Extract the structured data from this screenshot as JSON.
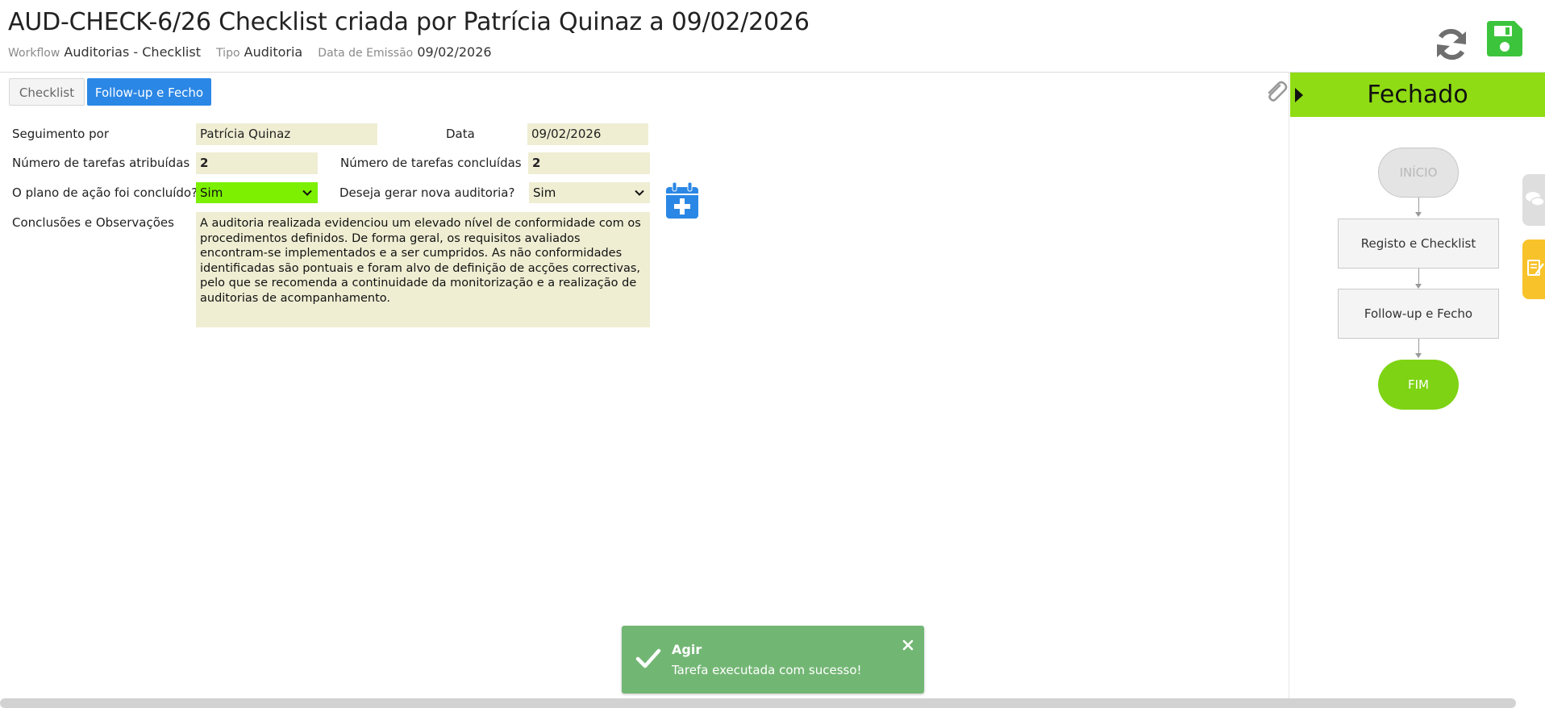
{
  "header": {
    "title": "AUD-CHECK-6/26 Checklist criada por Patrícia Quinaz a 09/02/2026",
    "workflow_label": "Workflow",
    "workflow_value": "Auditorias - Checklist",
    "tipo_label": "Tipo",
    "tipo_value": "Auditoria",
    "emissao_label": "Data de Emissão",
    "emissao_value": "09/02/2026"
  },
  "tabs": [
    {
      "label": "Checklist",
      "active": false
    },
    {
      "label": "Follow-up e Fecho",
      "active": true
    }
  ],
  "form": {
    "seguimento_label": "Seguimento por",
    "seguimento_value": "Patrícia Quinaz",
    "data_label": "Data",
    "data_value": "09/02/2026",
    "tarefas_atribuidas_label": "Número de tarefas atribuídas",
    "tarefas_atribuidas_value": "2",
    "tarefas_concluidas_label": "Número de tarefas concluídas",
    "tarefas_concluidas_value": "2",
    "plano_label": "O plano de ação foi concluído?",
    "plano_value": "Sim",
    "nova_auditoria_label": "Deseja gerar nova auditoria?",
    "nova_auditoria_value": "Sim",
    "conclusoes_label": "Conclusões e Observações",
    "conclusoes_value": "A auditoria realizada evidenciou um elevado nível de conformidade com os procedimentos definidos. De forma geral, os requisitos avaliados encontram-se implementados e a ser cumpridos. As não conformidades identificadas são pontuais e foram alvo de definição de acções correctivas, pelo que se recomenda a continuidade da monitorização e a realização de auditorias de acompanhamento."
  },
  "status": {
    "label": "Fechado",
    "color": "#8fdc14"
  },
  "flow": {
    "start": "INÍCIO",
    "steps": [
      "Registo e Checklist",
      "Follow-up e Fecho"
    ],
    "end": "FIM"
  },
  "toast": {
    "title": "Agir",
    "message": "Tarefa executada com sucesso!",
    "color": "#72b674"
  },
  "colors": {
    "accent": "#2b87e5",
    "field_bg": "#efeed3",
    "select_green": "#7cf000",
    "save_green": "#3cc43c",
    "side_yellow": "#f8c22a"
  },
  "icons": {
    "refresh": "refresh-icon",
    "save": "save-icon",
    "attach": "paperclip-icon",
    "calendar": "calendar-plus-icon",
    "chat": "chat-icon",
    "notes": "notes-icon",
    "check": "check-icon",
    "close": "close-icon"
  }
}
